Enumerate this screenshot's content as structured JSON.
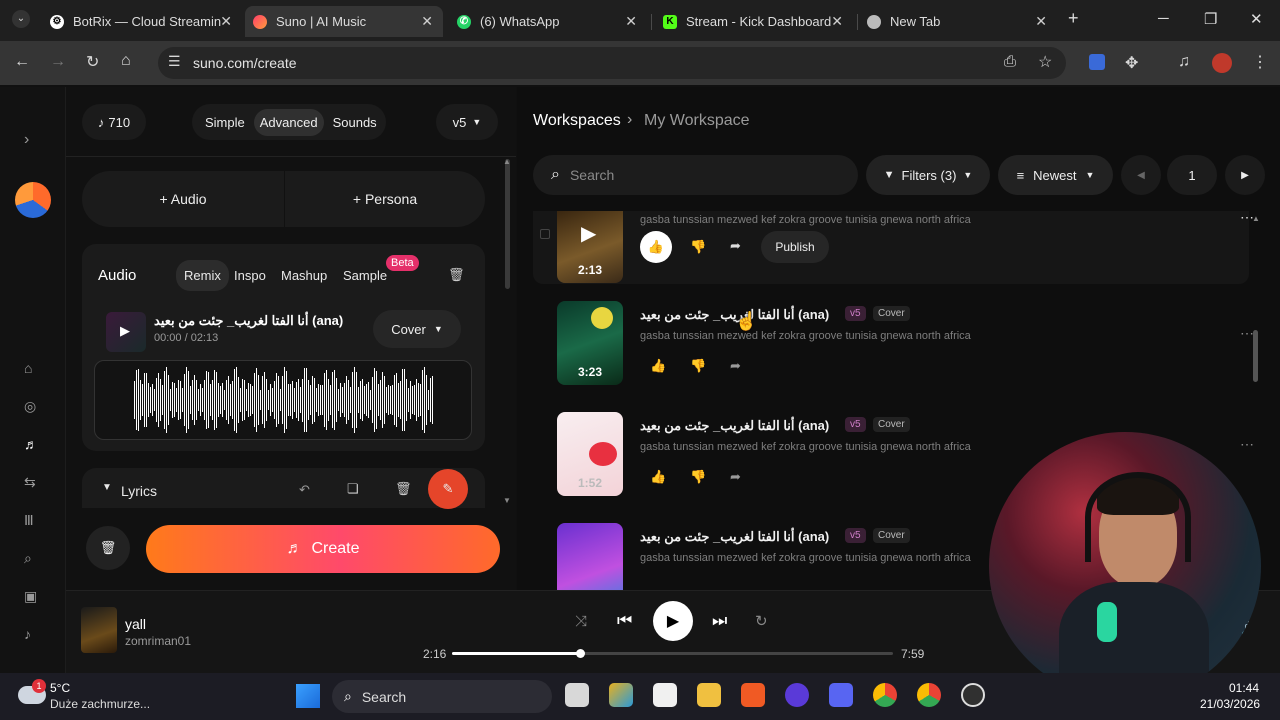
{
  "browser": {
    "tabs": [
      {
        "title": "BotRix — Cloud Streamin",
        "icon": "botrix-icon",
        "color": "#ffffff"
      },
      {
        "title": "Suno | AI Music",
        "icon": "suno-icon",
        "color": "#ff6a3d"
      },
      {
        "title": "(6) WhatsApp",
        "icon": "whatsapp-icon",
        "color": "#25d366"
      },
      {
        "title": "Stream - Kick Dashboard",
        "icon": "kick-icon",
        "color": "#53fc18"
      },
      {
        "title": "New Tab",
        "icon": "chrome-icon",
        "color": "#cccccc"
      }
    ],
    "url": "suno.com/create"
  },
  "create": {
    "credits": "710",
    "modes": [
      "Simple",
      "Advanced",
      "Sounds"
    ],
    "version": "v5",
    "add_audio": "+ Audio",
    "add_persona": "+ Persona",
    "audio_heading": "Audio",
    "audio_tabs": [
      "Remix",
      "Inspo",
      "Mashup",
      "Sample"
    ],
    "beta": "Beta",
    "clip_title": "أنا الفتا لغريب_ جئت من بعيد (ana)",
    "clip_time": "00:00 / 02:13",
    "cover": "Cover",
    "lyrics": "Lyrics",
    "create_button": "Create"
  },
  "workspace": {
    "breadcrumb_root": "Workspaces",
    "breadcrumb_current": "My Workspace",
    "search_placeholder": "Search",
    "filters": "Filters (3)",
    "sort": "Newest",
    "page": "1",
    "publish": "Publish",
    "songs": [
      {
        "title": "",
        "desc": "gasba tunssian mezwed kef zokra groove tunisia gnewa north africa",
        "duration": "2:13",
        "colors": [
          "#3a2a18",
          "#6a4a20"
        ]
      },
      {
        "title": "أنا الفتا لغريب_ جئت من بعيد (ana)",
        "version": "v5",
        "tag": "Cover",
        "desc": "gasba tunssian mezwed kef zokra groove tunisia gnewa north africa",
        "duration": "3:23",
        "colors": [
          "#0f4a3a",
          "#1a6a48"
        ]
      },
      {
        "title": "أنا الفتا لغريب_ جئت من بعيد (ana)",
        "version": "v5",
        "tag": "Cover",
        "desc": "gasba tunssian mezwed kef zokra groove tunisia gnewa north africa",
        "duration": "1:52",
        "colors": [
          "#f3e0e4",
          "#f7c5cc"
        ]
      },
      {
        "title": "أنا الفتا لغريب_ جئت من بعيد (ana)",
        "version": "v5",
        "tag": "Cover",
        "desc": "gasba tunssian mezwed kef zokra groove tunisia gnewa north africa",
        "duration": "",
        "colors": [
          "#7a38d8",
          "#c04fe0"
        ]
      }
    ]
  },
  "player": {
    "title": "yall",
    "artist": "zomriman01",
    "elapsed": "2:16",
    "total": "7:59",
    "progress": 0.29
  },
  "taskbar": {
    "weather_temp": "5°C",
    "weather_desc": "Duże zachmurze...",
    "weather_badge": "1",
    "search": "Search",
    "time": "01:44",
    "date": "21/03/2026"
  }
}
